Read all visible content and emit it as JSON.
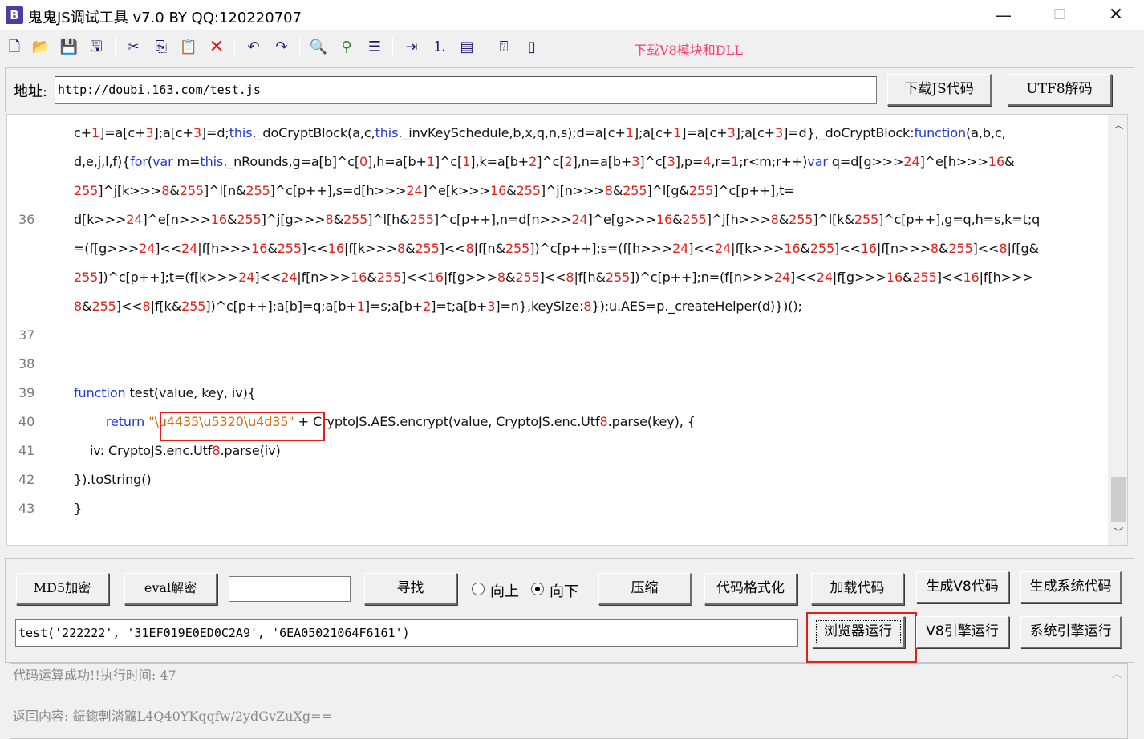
{
  "window": {
    "icon_letter": "B",
    "title": "鬼鬼JS调试工具 v7.0 BY QQ:120220707",
    "min_glyph": "—",
    "max_glyph": "☐",
    "close_glyph": "✕"
  },
  "toolbar": {
    "download_link": "下载V8模块和DLL"
  },
  "address": {
    "label": "地址:",
    "value": "http://doubi.163.com/test.js",
    "download_js_button": "下载JS代码",
    "utf8_decode_button": "UTF8解码"
  },
  "editor": {
    "lines": [
      {
        "num": "",
        "text": "c+1]=a[c+3];a[c+3]=d;this._doCryptBlock(a,c,this._invKeySchedule,b,x,q,n,s);d=a[c+1];a[c+1]=a[c+3];a[c+3]=d},_doCryptBlock:function(a,b,c,"
      },
      {
        "num": "",
        "text": "d,e,j,l,f){for(var m=this._nRounds,g=a[b]^c[0],h=a[b+1]^c[1],k=a[b+2]^c[2],n=a[b+3]^c[3],p=4,r=1;r<m;r++)var q=d[g>>>24]^e[h>>>16&"
      },
      {
        "num": "",
        "text": "255]^j[k>>>8&255]^l[n&255]^c[p++],s=d[h>>>24]^e[k>>>16&255]^j[n>>>8&255]^l[g&255]^c[p++],t="
      },
      {
        "num": "36",
        "text": "d[k>>>24]^e[n>>>16&255]^j[g>>>8&255]^l[h&255]^c[p++],n=d[n>>>24]^e[g>>>16&255]^j[h>>>8&255]^l[k&255]^c[p++],g=q,h=s,k=t;q"
      },
      {
        "num": "",
        "text": "=(f[g>>>24]<<24|f[h>>>16&255]<<16|f[k>>>8&255]<<8|f[n&255])^c[p++];s=(f[h>>>24]<<24|f[k>>>16&255]<<16|f[n>>>8&255]<<8|f[g&"
      },
      {
        "num": "",
        "text": "255])^c[p++];t=(f[k>>>24]<<24|f[n>>>16&255]<<16|f[g>>>8&255]<<8|f[h&255])^c[p++];n=(f[n>>>24]<<24|f[g>>>16&255]<<16|f[h>>>"
      },
      {
        "num": "",
        "text": "8&255]<<8|f[k&255])^c[p++];a[b]=q;a[b+1]=s;a[b+2]=t;a[b+3]=n},keySize:8});u.AES=p._createHelper(d)})();"
      },
      {
        "num": "37",
        "text": ""
      },
      {
        "num": "38",
        "text": ""
      },
      {
        "num": "39",
        "text": "function test(value, key, iv){"
      },
      {
        "num": "40",
        "text": "        return \"\\u4435\\u5320\\u4d35\" + CryptoJS.AES.encrypt(value, CryptoJS.enc.Utf8.parse(key), {"
      },
      {
        "num": "41",
        "text": "    iv: CryptoJS.enc.Utf8.parse(iv)"
      },
      {
        "num": "42",
        "text": "}).toString()"
      },
      {
        "num": "43",
        "text": "}"
      }
    ]
  },
  "controls": {
    "md5_button": "MD5加密",
    "eval_decode_button": "eval解密",
    "search_value": "",
    "find_button": "寻找",
    "radio_up_label": "向上",
    "radio_down_label": "向下",
    "radio_selected": "down",
    "compress_button": "压缩",
    "format_button": "代码格式化",
    "load_code_button": "加载代码",
    "gen_v8_button": "生成V8代码",
    "gen_sys_button": "生成系统代码",
    "command_value": "test('222222', '31EF019E0ED0C2A9', '6EA05021064F6161')",
    "browser_run_button": "浏览器运行",
    "v8_run_button": "V8引擎运行",
    "sys_run_button": "系统引擎运行"
  },
  "output": {
    "line1": "代码运算成功!!执行时间: 47",
    "line2": "返回内容: 鋠鍃剸涾龞L4Q40YKqqfw/2ydGvZuXg=="
  },
  "colors": {
    "keyword": "#1f3bd7",
    "number": "#e0201a",
    "string": "#d26b0c",
    "highlight_box": "#e0201a",
    "download_link": "#ff3b6b"
  }
}
